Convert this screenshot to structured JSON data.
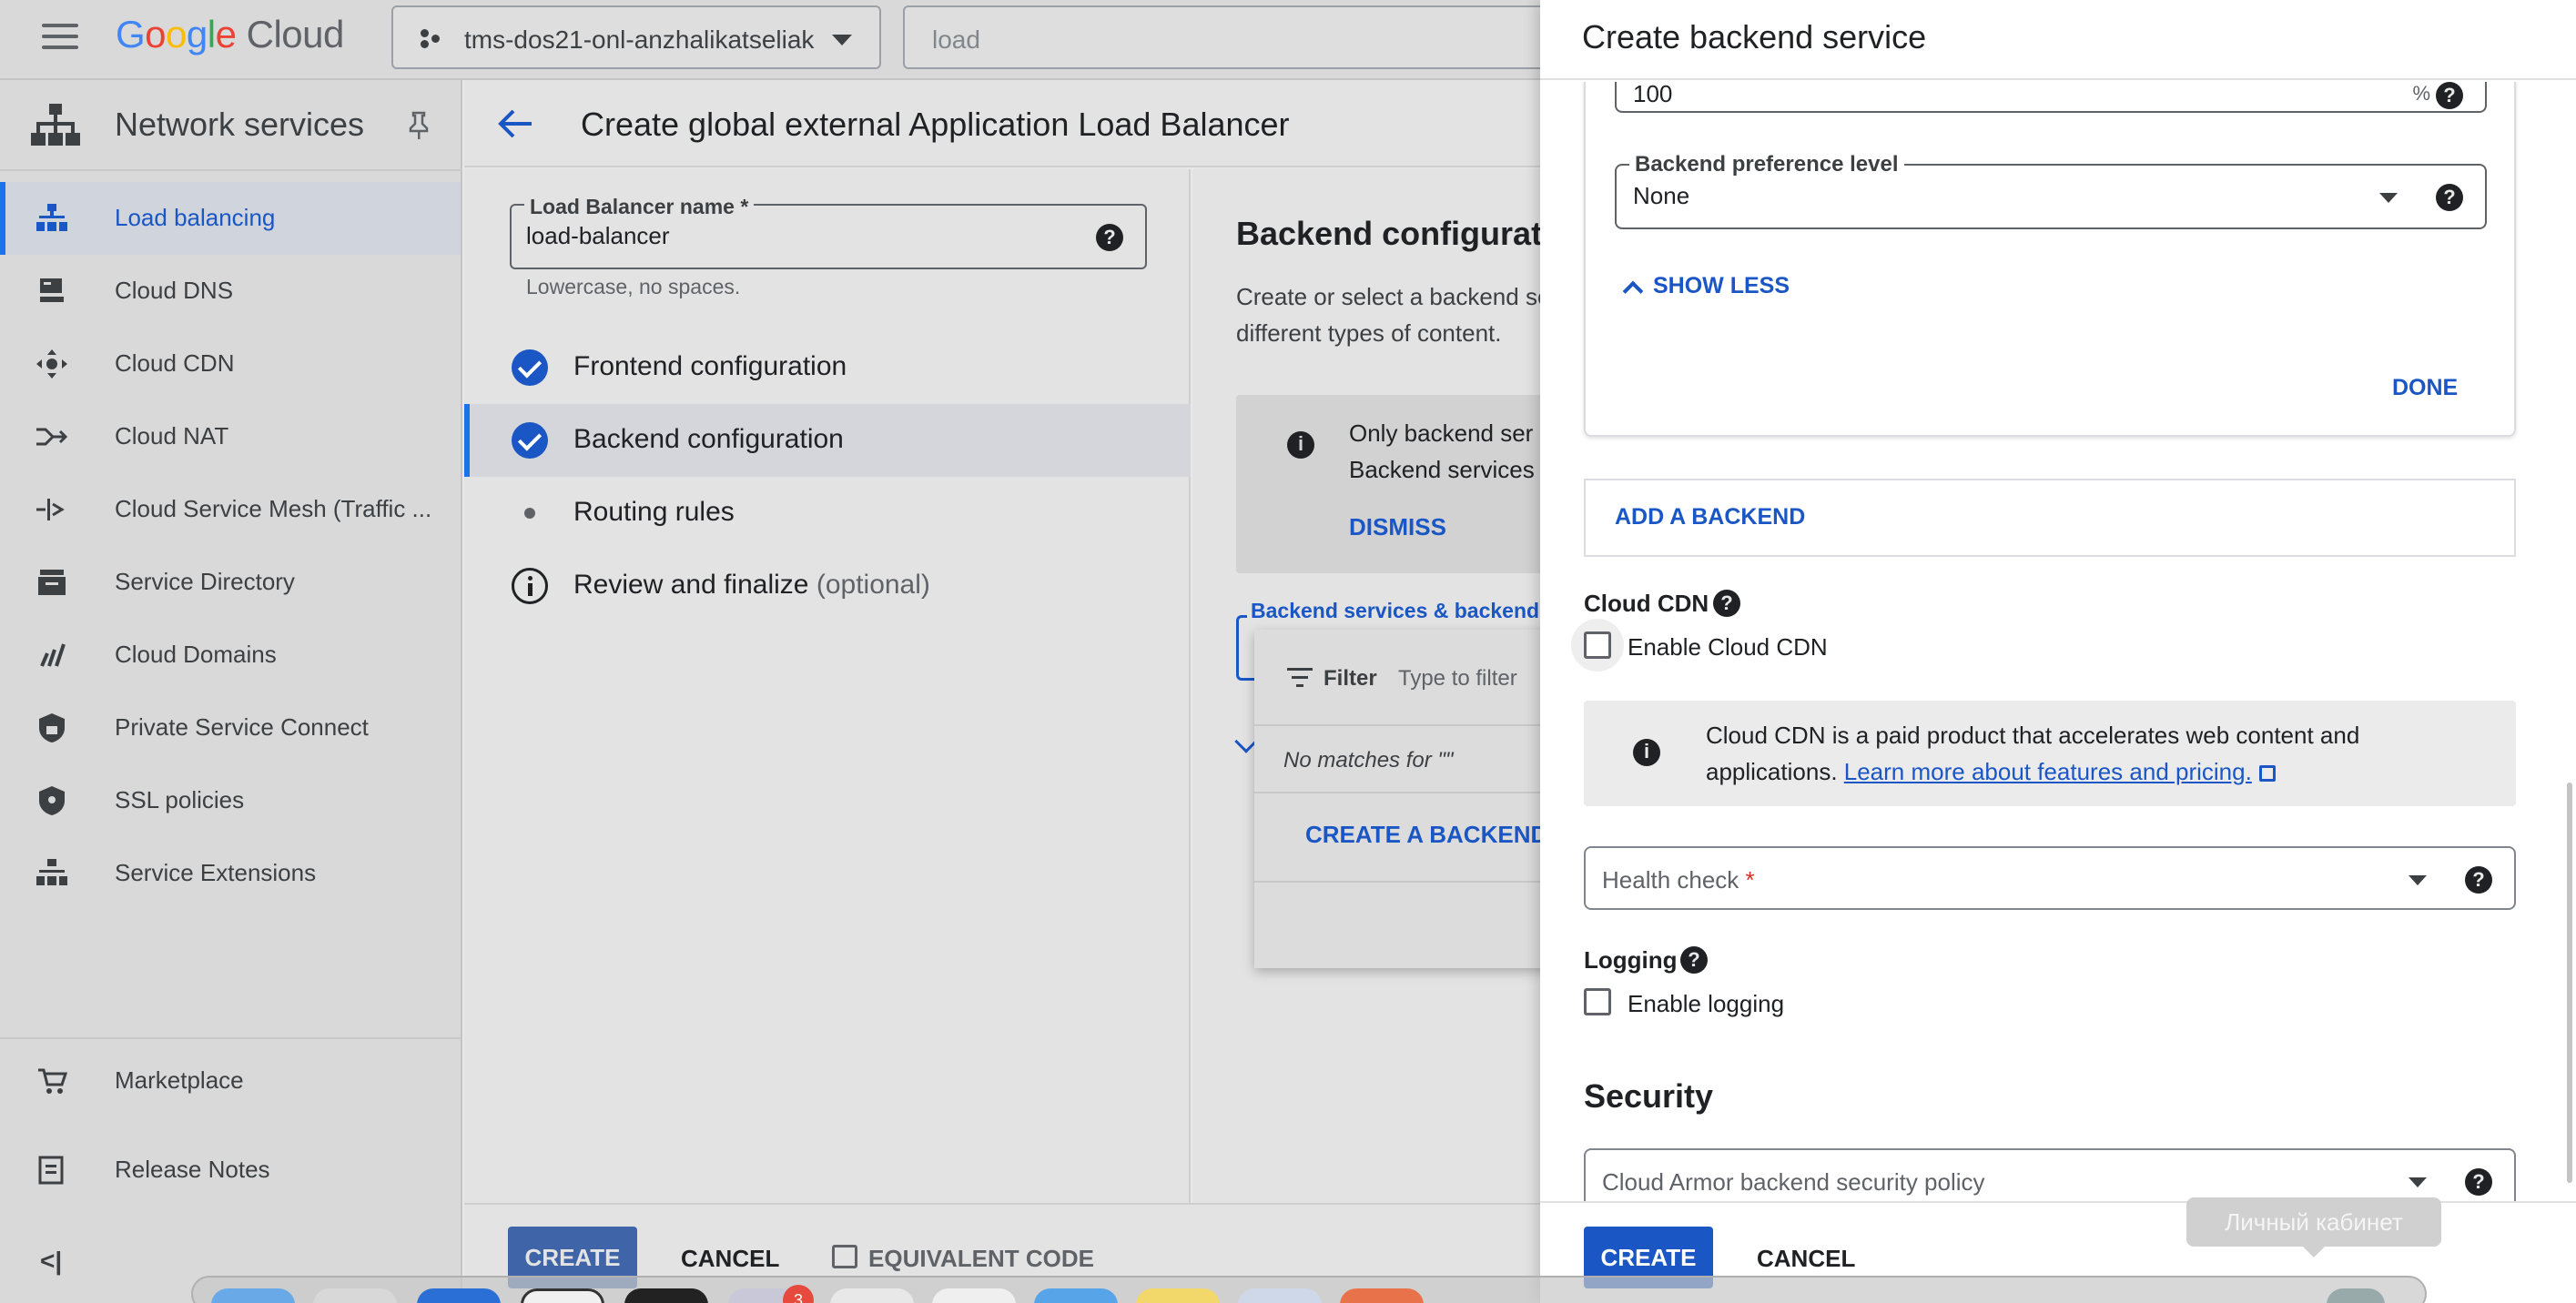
{
  "header": {
    "logo_google": "Google",
    "logo_cloud": "Cloud",
    "project_name": "tms-dos21-onl-anzhalikatseliak",
    "search_value": "load"
  },
  "sidebar": {
    "title": "Network services",
    "items": [
      {
        "label": "Load balancing",
        "icon": "load-balancing-icon",
        "active": true
      },
      {
        "label": "Cloud DNS",
        "icon": "dns-icon"
      },
      {
        "label": "Cloud CDN",
        "icon": "cdn-icon"
      },
      {
        "label": "Cloud NAT",
        "icon": "nat-icon"
      },
      {
        "label": "Cloud Service Mesh (Traffic ...",
        "icon": "service-mesh-icon"
      },
      {
        "label": "Service Directory",
        "icon": "service-directory-icon"
      },
      {
        "label": "Cloud Domains",
        "icon": "domains-icon"
      },
      {
        "label": "Private Service Connect",
        "icon": "private-service-connect-icon"
      },
      {
        "label": "SSL policies",
        "icon": "ssl-shield-icon"
      },
      {
        "label": "Service Extensions",
        "icon": "service-extensions-icon"
      }
    ],
    "bottom": [
      {
        "label": "Marketplace",
        "icon": "cart-icon"
      },
      {
        "label": "Release Notes",
        "icon": "notes-icon"
      }
    ],
    "collapse_glyph": "<|"
  },
  "page": {
    "title": "Create global external Application Load Balancer",
    "lb_name_label": "Load Balancer name *",
    "lb_name_value": "load-balancer",
    "lb_name_hint": "Lowercase, no spaces.",
    "steps": [
      {
        "label": "Frontend configuration",
        "state": "done"
      },
      {
        "label": "Backend configuration",
        "state": "done",
        "active": true
      },
      {
        "label": "Routing rules",
        "state": "pending"
      },
      {
        "label": "Review and finalize",
        "optional": "(optional)",
        "state": "info"
      }
    ],
    "config_title": "Backend configuratio",
    "config_desc_1": "Create or select a backend se",
    "config_desc_2": "different types of content.",
    "notice_1": "Only backend ser",
    "notice_2": "Backend services",
    "notice_dismiss": "DISMISS",
    "backend_field_label": "Backend services & backend b",
    "dropdown": {
      "filter_label": "Filter",
      "filter_placeholder": "Type to filter",
      "no_matches": "No matches for \"\"",
      "create_link": "CREATE A BACKEND S"
    },
    "footer": {
      "create": "CREATE",
      "cancel": "CANCEL",
      "equivalent_code": "EQUIVALENT CODE"
    }
  },
  "drawer": {
    "title": "Create backend service",
    "partial_value": "100",
    "partial_unit": "%",
    "preference_label": "Backend preference level",
    "preference_value": "None",
    "show_less": "SHOW LESS",
    "done": "DONE",
    "add_backend": "ADD A BACKEND",
    "cdn_section": "Cloud CDN",
    "cdn_checkbox": "Enable Cloud CDN",
    "cdn_checked": false,
    "cdn_info_1": "Cloud CDN is a paid product that accelerates web content and",
    "cdn_info_2a": "applications. ",
    "cdn_info_link": "Learn more about features and pricing.",
    "health_check_placeholder": "Health check ",
    "health_check_required": "*",
    "logging_section": "Logging",
    "logging_checkbox": "Enable logging",
    "logging_checked": false,
    "security_title": "Security",
    "armor_placeholder": "Cloud Armor backend security policy",
    "footer": {
      "create": "CREATE",
      "cancel": "CANCEL"
    }
  },
  "tooltip": "Личный кабинет",
  "dock": {
    "badge_count": "3"
  },
  "colors": {
    "accent": "#1a56c4",
    "primary_button": "#1a56c4",
    "required": "#d93025"
  }
}
